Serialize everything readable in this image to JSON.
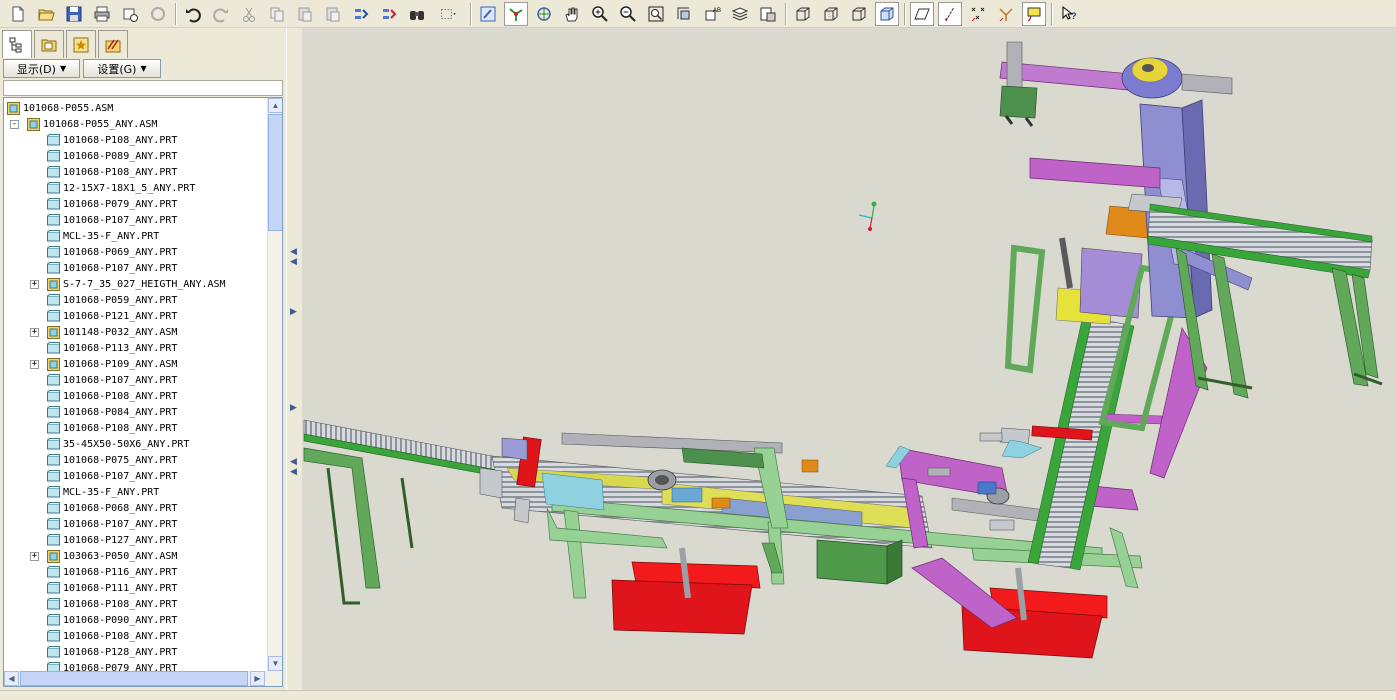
{
  "tree_tabs": [
    "model-tree",
    "layers",
    "favorites",
    "tools"
  ],
  "panel_menus": {
    "display_label": "显示(D)",
    "settings_label": "设置(G)"
  },
  "tree": {
    "root": "101068-P055.ASM",
    "items": [
      {
        "label": "101068-P055_ANY.ASM",
        "type": "asm",
        "level": 1,
        "expand": "-"
      },
      {
        "label": "101068-P108_ANY.PRT",
        "type": "prt",
        "level": 2
      },
      {
        "label": "101068-P089_ANY.PRT",
        "type": "prt",
        "level": 2
      },
      {
        "label": "101068-P108_ANY.PRT",
        "type": "prt",
        "level": 2
      },
      {
        "label": "12-15X7-18X1_5_ANY.PRT",
        "type": "prt",
        "level": 2
      },
      {
        "label": "101068-P079_ANY.PRT",
        "type": "prt",
        "level": 2
      },
      {
        "label": "101068-P107_ANY.PRT",
        "type": "prt",
        "level": 2
      },
      {
        "label": "MCL-35-F_ANY.PRT",
        "type": "prt",
        "level": 2
      },
      {
        "label": "101068-P069_ANY.PRT",
        "type": "prt",
        "level": 2
      },
      {
        "label": "101068-P107_ANY.PRT",
        "type": "prt",
        "level": 2
      },
      {
        "label": "S-7-7_35_027_HEIGTH_ANY.ASM",
        "type": "asm",
        "level": 2,
        "expand": "+"
      },
      {
        "label": "101068-P059_ANY.PRT",
        "type": "prt",
        "level": 2
      },
      {
        "label": "101068-P121_ANY.PRT",
        "type": "prt",
        "level": 2
      },
      {
        "label": "101148-P032_ANY.ASM",
        "type": "asm",
        "level": 2,
        "expand": "+"
      },
      {
        "label": "101068-P113_ANY.PRT",
        "type": "prt",
        "level": 2
      },
      {
        "label": "101068-P109_ANY.ASM",
        "type": "asm",
        "level": 2,
        "expand": "+"
      },
      {
        "label": "101068-P107_ANY.PRT",
        "type": "prt",
        "level": 2
      },
      {
        "label": "101068-P108_ANY.PRT",
        "type": "prt",
        "level": 2
      },
      {
        "label": "101068-P084_ANY.PRT",
        "type": "prt",
        "level": 2
      },
      {
        "label": "101068-P108_ANY.PRT",
        "type": "prt",
        "level": 2
      },
      {
        "label": "35-45X50-50X6_ANY.PRT",
        "type": "prt",
        "level": 2
      },
      {
        "label": "101068-P075_ANY.PRT",
        "type": "prt",
        "level": 2
      },
      {
        "label": "101068-P107_ANY.PRT",
        "type": "prt",
        "level": 2
      },
      {
        "label": "MCL-35-F_ANY.PRT",
        "type": "prt",
        "level": 2
      },
      {
        "label": "101068-P068_ANY.PRT",
        "type": "prt",
        "level": 2
      },
      {
        "label": "101068-P107_ANY.PRT",
        "type": "prt",
        "level": 2
      },
      {
        "label": "101068-P127_ANY.PRT",
        "type": "prt",
        "level": 2
      },
      {
        "label": "103063-P050_ANY.ASM",
        "type": "asm",
        "level": 2,
        "expand": "+"
      },
      {
        "label": "101068-P116_ANY.PRT",
        "type": "prt",
        "level": 2
      },
      {
        "label": "101068-P111_ANY.PRT",
        "type": "prt",
        "level": 2
      },
      {
        "label": "101068-P108_ANY.PRT",
        "type": "prt",
        "level": 2
      },
      {
        "label": "101068-P090_ANY.PRT",
        "type": "prt",
        "level": 2
      },
      {
        "label": "101068-P108_ANY.PRT",
        "type": "prt",
        "level": 2
      },
      {
        "label": "101068-P128_ANY.PRT",
        "type": "prt",
        "level": 2
      },
      {
        "label": "101068-P079_ANY.PRT",
        "type": "prt",
        "level": 2
      }
    ]
  },
  "colors": {
    "frame_green": "#8fce8a",
    "frame_dark_green": "#4c8a3d",
    "conveyor_green": "#3aa53a",
    "magenta": "#c063c9",
    "red": "#e0141b",
    "violet": "#9b9bd6",
    "yellow": "#e6e23a",
    "viewport_bg": "#d9d9d0"
  }
}
